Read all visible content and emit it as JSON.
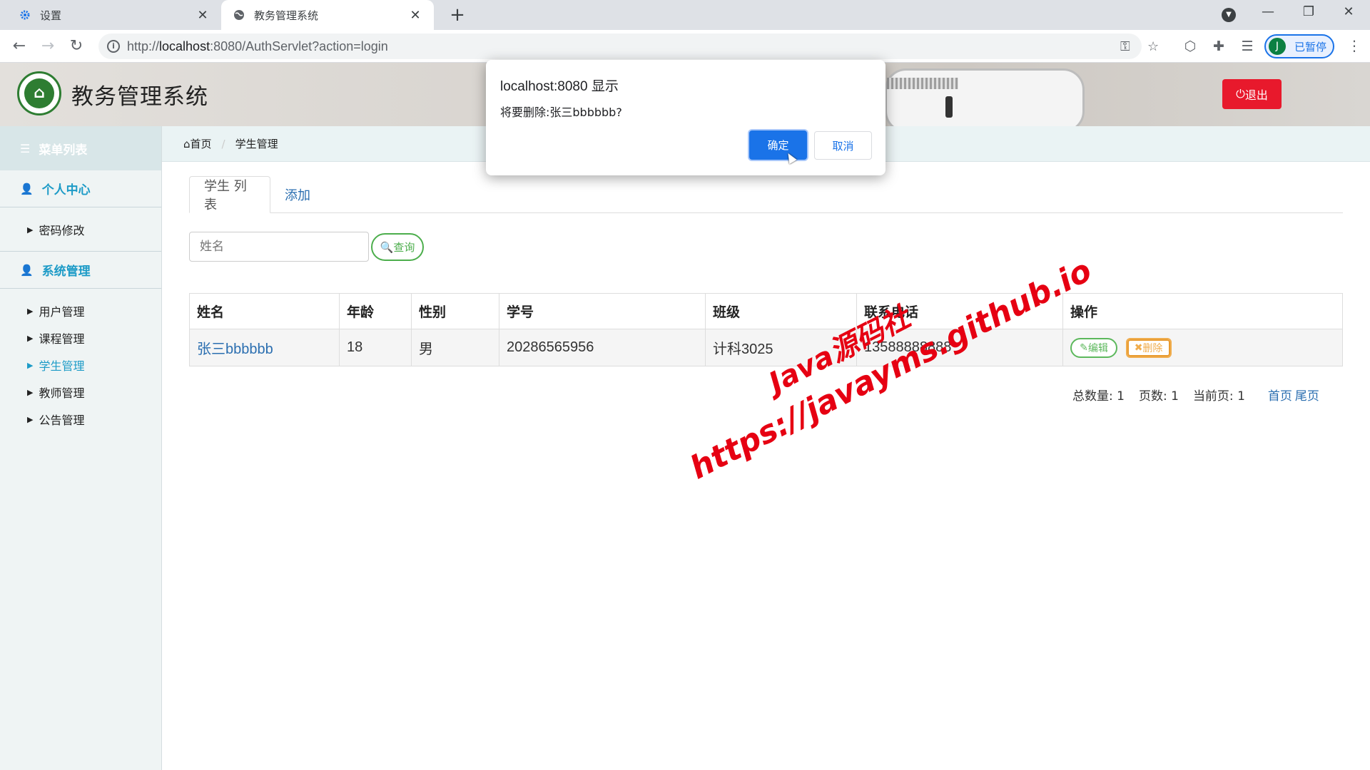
{
  "browser": {
    "tabs": [
      {
        "title": "设置",
        "icon": "gear-icon",
        "active": false
      },
      {
        "title": "教务管理系统",
        "icon": "globe-icon",
        "active": true
      }
    ],
    "url_prefix": "http://",
    "url_host": "localhost",
    "url_rest": ":8080/AuthServlet?action=login",
    "profile_initial": "J",
    "profile_label": "已暂停"
  },
  "app": {
    "title": "教务管理系统",
    "logout_label": "退出",
    "logo_glyph": "⌂"
  },
  "sidebar": {
    "header": "菜单列表",
    "groups": [
      {
        "label": "个人中心",
        "items": [
          {
            "label": "密码修改"
          }
        ]
      },
      {
        "label": "系统管理",
        "items": [
          {
            "label": "用户管理"
          },
          {
            "label": "课程管理"
          },
          {
            "label": "学生管理",
            "active": true
          },
          {
            "label": "教师管理"
          },
          {
            "label": "公告管理"
          }
        ]
      }
    ]
  },
  "breadcrumb": {
    "home": "首页",
    "current": "学生管理"
  },
  "tabs": [
    {
      "label": "学生 列表",
      "active": true
    },
    {
      "label": "添加",
      "active": false
    }
  ],
  "search": {
    "placeholder": "姓名",
    "button_label": "查询"
  },
  "table": {
    "columns": [
      "姓名",
      "年龄",
      "性别",
      "学号",
      "班级",
      "联系电话",
      "操作"
    ],
    "rows": [
      {
        "name": "张三bbbbbb",
        "age": "18",
        "gender": "男",
        "student_id": "20286565956",
        "class": "计科3025",
        "phone": "13588888888",
        "edit_label": "编辑",
        "delete_label": "删除"
      }
    ]
  },
  "pager": {
    "total_label": "总数量:",
    "total": "1",
    "pages_label": "页数:",
    "pages": "1",
    "current_label": "当前页:",
    "current": "1",
    "first": "首页",
    "last": "尾页"
  },
  "watermark": {
    "line1": "Java源码社",
    "line2": "https://javayms.github.io"
  },
  "dialog": {
    "title": "localhost:8080 显示",
    "message": "将要删除:张三bbbbbb?",
    "ok_label": "确定",
    "cancel_label": "取消"
  },
  "colors": {
    "accent": "#1d9bc7",
    "danger": "#e8192c",
    "link": "#2a6eb0",
    "success": "#4cae4c",
    "warning": "#f0ad4e"
  }
}
